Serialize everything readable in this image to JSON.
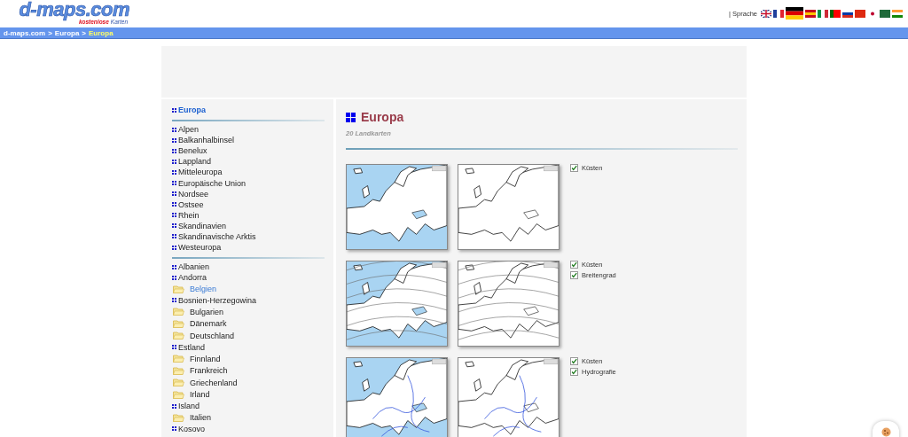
{
  "header": {
    "logo": "d-maps.com",
    "tagline": [
      "kostenlose",
      "Karten"
    ],
    "language_label": "| Sprache"
  },
  "breadcrumb": {
    "separator": ">",
    "items": [
      {
        "label": "d-maps.com",
        "current": false
      },
      {
        "label": "Europa",
        "current": false
      },
      {
        "label": "Europa",
        "current": true
      }
    ]
  },
  "sidebar": {
    "title": "Europa",
    "regions": [
      {
        "label": "Alpen"
      },
      {
        "label": "Balkanhalbinsel"
      },
      {
        "label": "Benelux"
      },
      {
        "label": "Lappland"
      },
      {
        "label": "Mitteleuropa"
      },
      {
        "label": "Europäische Union"
      },
      {
        "label": "Nordsee"
      },
      {
        "label": "Ostsee"
      },
      {
        "label": "Rhein"
      },
      {
        "label": "Skandinavien"
      },
      {
        "label": "Skandinavische Arktis"
      },
      {
        "label": "Westeuropa"
      }
    ],
    "countries": [
      {
        "label": "Albanien",
        "kind": "bullet",
        "selected": false
      },
      {
        "label": "Andorra",
        "kind": "bullet",
        "selected": false
      },
      {
        "label": "Belgien",
        "kind": "folder",
        "selected": true
      },
      {
        "label": "Bosnien-Herzegowina",
        "kind": "bullet",
        "selected": false
      },
      {
        "label": "Bulgarien",
        "kind": "folder",
        "selected": false
      },
      {
        "label": "Dänemark",
        "kind": "folder",
        "selected": false
      },
      {
        "label": "Deutschland",
        "kind": "folder",
        "selected": false
      },
      {
        "label": "Estland",
        "kind": "bullet",
        "selected": false
      },
      {
        "label": "Finnland",
        "kind": "folder",
        "selected": false
      },
      {
        "label": "Frankreich",
        "kind": "folder",
        "selected": false
      },
      {
        "label": "Griechenland",
        "kind": "folder",
        "selected": false
      },
      {
        "label": "Irland",
        "kind": "folder",
        "selected": false
      },
      {
        "label": "Island",
        "kind": "bullet",
        "selected": false
      },
      {
        "label": "Italien",
        "kind": "folder",
        "selected": false
      },
      {
        "label": "Kosovo",
        "kind": "bullet",
        "selected": false
      }
    ]
  },
  "content": {
    "title": "Europa",
    "count": "20 Landkarten",
    "maps": [
      {
        "layers": [
          {
            "label": "Küsten",
            "checked": true
          }
        ]
      },
      {
        "layers": [
          {
            "label": "Küsten",
            "checked": true
          },
          {
            "label": "Breitengrad",
            "checked": true
          }
        ]
      },
      {
        "layers": [
          {
            "label": "Küsten",
            "checked": true
          },
          {
            "label": "Hydrografie",
            "checked": true
          }
        ]
      }
    ]
  }
}
